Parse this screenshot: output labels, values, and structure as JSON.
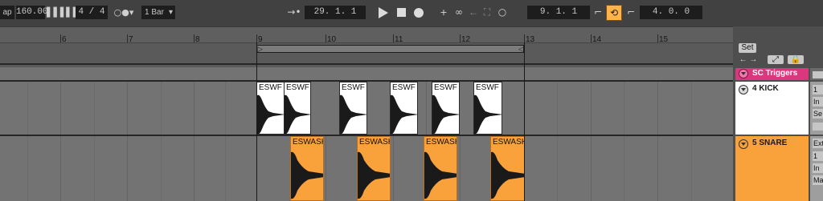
{
  "transport": {
    "tap_label": "ap",
    "tempo": "160.00",
    "time_signature": "4 / 4",
    "quantize": "1 Bar",
    "arrangement_position": "29.  1.  1",
    "loop_start": "9.  1.  1",
    "loop_length": "4.  0.  0"
  },
  "ruler": {
    "bars": [
      "6",
      "7",
      "8",
      "9",
      "10",
      "11",
      "12",
      "13",
      "14",
      "15"
    ]
  },
  "tracks": [
    {
      "name": "SC Triggers",
      "color": "#d9387e"
    },
    {
      "name": "4 KICK",
      "color": "#ffffff",
      "clips": [
        "ESWF K",
        "ESWF K",
        "ESWF K",
        "ESWF K",
        "ESWF K",
        "ESWF K"
      ]
    },
    {
      "name": "5 SNARE",
      "color": "#f9a13b",
      "clips": [
        "ESWASH",
        "ESWASH",
        "ESWASH",
        "ESWASH"
      ]
    }
  ],
  "right_panel": {
    "set_label": "Set",
    "mixer_cells": [
      "1",
      "In",
      "Se",
      "Ext",
      "1",
      "In",
      "Ma"
    ]
  },
  "colors": {
    "accent_loop": "#ffb44a",
    "kick_clip": "#ffffff",
    "snare_clip": "#f9a13b",
    "sc_triggers": "#d9387e"
  }
}
